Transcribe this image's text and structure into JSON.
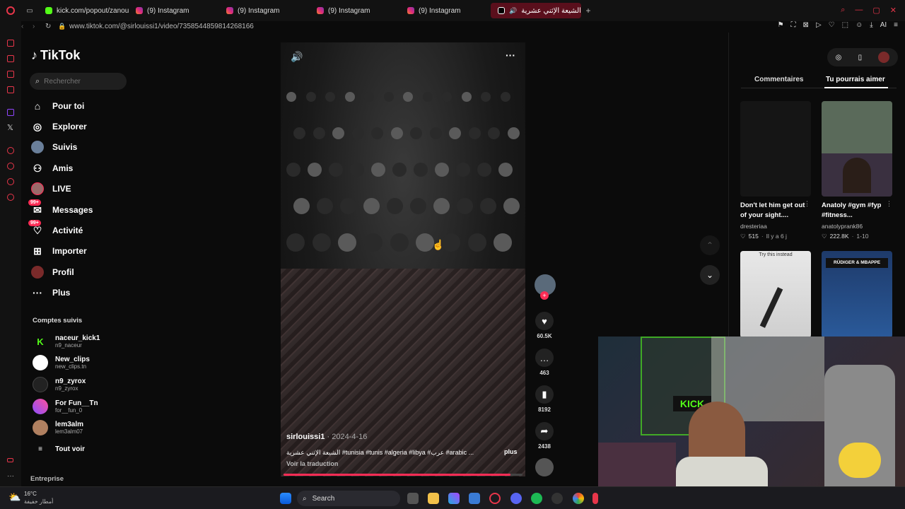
{
  "browser": {
    "tabs": [
      {
        "label": "kick.com/popout/zanoun",
        "icon": "kick-icon"
      },
      {
        "label": "(9) Instagram",
        "icon": "instagram-icon"
      },
      {
        "label": "(9) Instagram",
        "icon": "instagram-icon"
      },
      {
        "label": "(9) Instagram",
        "icon": "instagram-icon"
      },
      {
        "label": "(9) Instagram",
        "icon": "instagram-icon"
      },
      {
        "label": "الشيعة الإثني عشرية #ya",
        "icon": "tiktok-icon"
      }
    ],
    "url": "www.tiktok.com/@sirlouissi1/video/7358544859814268166",
    "ai_label": "AI"
  },
  "tiktok": {
    "logo": "TikTok",
    "search_placeholder": "Rechercher",
    "nav": [
      {
        "label": "Pour toi",
        "icon": "home-icon"
      },
      {
        "label": "Explorer",
        "icon": "compass-icon"
      },
      {
        "label": "Suivis",
        "icon": "avatar"
      },
      {
        "label": "Amis",
        "icon": "friends-icon"
      },
      {
        "label": "LIVE",
        "icon": "avatar"
      },
      {
        "label": "Messages",
        "icon": "message-icon",
        "badge": "99+"
      },
      {
        "label": "Activité",
        "icon": "activity-icon",
        "badge": "99+"
      },
      {
        "label": "Importer",
        "icon": "upload-icon"
      },
      {
        "label": "Profil",
        "icon": "avatar"
      },
      {
        "label": "Plus",
        "icon": "more-icon"
      }
    ],
    "followed_title": "Comptes suivis",
    "followed": [
      {
        "name": "naceur_kick1",
        "handle": "n9_naceur",
        "color": "#53fc18"
      },
      {
        "name": "New_clips",
        "handle": "new_clips.tn",
        "color": "#ffffff"
      },
      {
        "name": "n9_zyrox",
        "handle": "n9_zyrox",
        "color": "#222222"
      },
      {
        "name": "For Fun__Tn",
        "handle": "for__fun_0",
        "color": "#8a4fff"
      },
      {
        "name": "lem3alm",
        "handle": "lem3alm07",
        "color": "#b08060"
      }
    ],
    "see_all": "Tout voir",
    "company": "Entreprise"
  },
  "video": {
    "author": "sirlouissi1",
    "date": "2024-4-16",
    "caption": "الشيعة الإثني عشرية #tunisia #tunis #algeria #libya #عرب #arabic ...",
    "more": "plus",
    "translate": "Voir la traduction",
    "progress": 0.95,
    "likes": "60.5K",
    "comments": "463",
    "saves": "8192",
    "shares": "2438"
  },
  "right_panel": {
    "tabs": [
      "Commentaires",
      "Tu pourrais aimer"
    ],
    "active_tab": 1,
    "cards": [
      {
        "title": "Don't let him get out of your sight....",
        "author": "dresteriaa",
        "likes": "515",
        "time": "Il y a 6 j"
      },
      {
        "title": "Anatoly #gym #fyp #fitness...",
        "author": "anatolyprank86",
        "likes": "222.8K",
        "time": "1-10"
      }
    ],
    "thumb_texts": [
      "Try this instead",
      "RÜDIGER & MBAPPE"
    ]
  },
  "webcam": {
    "sign": "KICK"
  },
  "taskbar": {
    "weather_temp": "16°C",
    "weather_desc": "أمطار خفيفة",
    "search": "Search"
  },
  "colors": {
    "accent": "#fe2c55",
    "kick": "#53fc18",
    "opera": "#e8364a"
  }
}
